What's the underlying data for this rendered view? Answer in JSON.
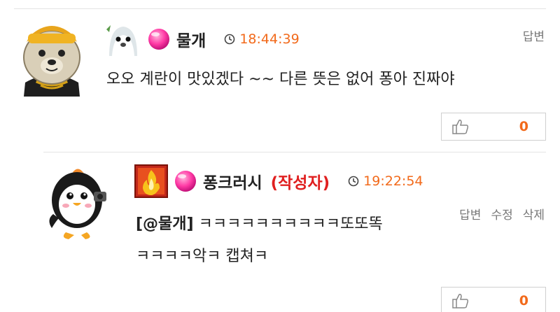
{
  "comments": [
    {
      "nickname": "물개",
      "time": "18:44:39",
      "actions": [
        "답변"
      ],
      "text": "오오 계란이 맛있겠다 ~~ 다른 뜻은 없어 퐁아 진짜야",
      "likes": "0",
      "avatar_icon": "seal-avatar-icon",
      "level_icon": "seal-level-icon"
    },
    {
      "nickname": "퐁크러시",
      "author_tag": "(작성자)",
      "time": "19:22:54",
      "actions": [
        "답변",
        "수정",
        "삭제"
      ],
      "mention": "[@물개]",
      "text_line1_rest": " ㅋㅋㅋㅋㅋㅋㅋㅋㅋㅋ또또똑",
      "text_line2": "ㅋㅋㅋㅋ악ㅋ 캡쳐ㅋ",
      "likes": "0",
      "avatar_icon": "penguin-avatar-icon",
      "level_icon": "flame-level-icon"
    }
  ],
  "colors": {
    "time": "#f26a1b",
    "author_tag": "#e02020",
    "like_count": "#f26a1b",
    "candy": "#ff3aa5"
  }
}
